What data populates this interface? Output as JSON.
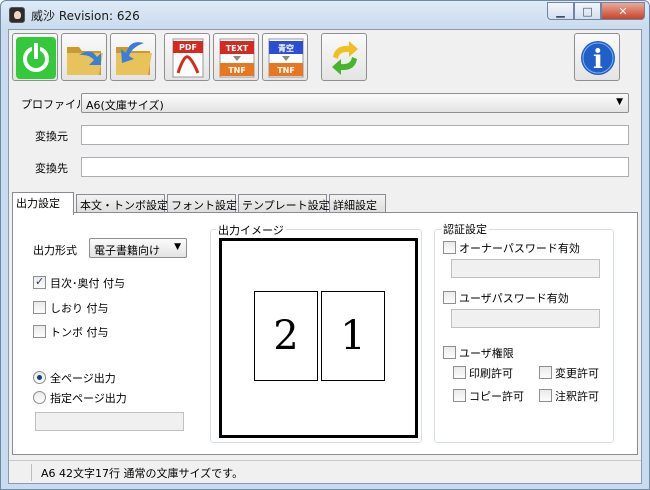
{
  "window": {
    "title": "威沙 Revision: 626",
    "controls": [
      "minimize",
      "maximize",
      "close"
    ]
  },
  "toolbar": {
    "buttons": [
      {
        "name": "power",
        "icon": "power-icon"
      },
      {
        "name": "open-folder",
        "icon": "folder-arrow-right-icon"
      },
      {
        "name": "output-folder",
        "icon": "folder-arrow-back-icon"
      },
      {
        "name": "pdf",
        "icon": "pdf-file-icon",
        "label": "PDF"
      },
      {
        "name": "text-to-tnf",
        "icon": "text-tnf-icon",
        "top": "TEXT",
        "bottom": "TNF"
      },
      {
        "name": "aozora-to-tnf",
        "icon": "aozora-tnf-icon",
        "top": "青空",
        "bottom": "TNF"
      },
      {
        "name": "refresh",
        "icon": "refresh-icon"
      },
      {
        "name": "info",
        "icon": "info-icon",
        "label": "i"
      }
    ]
  },
  "form": {
    "profile_label": "プロファイル",
    "profile_value": "A6(文庫サイズ)",
    "source_label": "変換元",
    "source_value": "",
    "dest_label": "変換先",
    "dest_value": ""
  },
  "tabs": [
    {
      "label": "出力設定",
      "active": true
    },
    {
      "label": "本文・トンボ設定",
      "active": false
    },
    {
      "label": "フォント設定",
      "active": false
    },
    {
      "label": "テンプレート設定",
      "active": false
    },
    {
      "label": "詳細設定",
      "active": false
    }
  ],
  "output": {
    "format_label": "出力形式",
    "format_value": "電子書籍向け",
    "toc_label": "目次･奥付 付与",
    "toc_checked": true,
    "bookmark_label": "しおり 付与",
    "bookmark_checked": false,
    "trim_label": "トンボ 付与",
    "trim_checked": false,
    "all_pages_label": "全ページ出力",
    "all_pages_selected": true,
    "specified_pages_label": "指定ページ出力",
    "specified_pages_selected": false,
    "page_range_value": ""
  },
  "preview": {
    "title": "出力イメージ",
    "left_page": "2",
    "right_page": "1"
  },
  "auth": {
    "title": "認証設定",
    "owner_password_label": "オーナーパスワード有効",
    "owner_password_checked": false,
    "user_password_label": "ユーザパスワード有効",
    "user_password_checked": false,
    "user_permissions_label": "ユーザ権限",
    "user_permissions_checked": false,
    "print_label": "印刷許可",
    "change_label": "変更許可",
    "copy_label": "コピー許可",
    "annotate_label": "注釈許可"
  },
  "status": {
    "text": "A6 42文字17行 通常の文庫サイズです。"
  },
  "colors": {
    "titlebar": "#c9dbee",
    "close_button": "#c7432a",
    "client_bg": "#f0f0f0"
  }
}
